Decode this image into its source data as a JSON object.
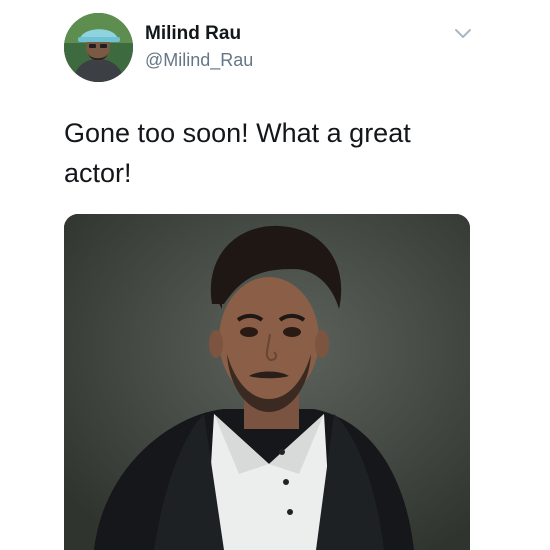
{
  "tweet": {
    "author": {
      "display_name": "Milind Rau",
      "handle": "@Milind_Rau"
    },
    "text": "Gone too soon! What a great actor!",
    "icons": {
      "menu": "chevron-down-icon"
    },
    "colors": {
      "name": "#14171a",
      "handle": "#657786",
      "caret": "#aab8c2"
    }
  }
}
